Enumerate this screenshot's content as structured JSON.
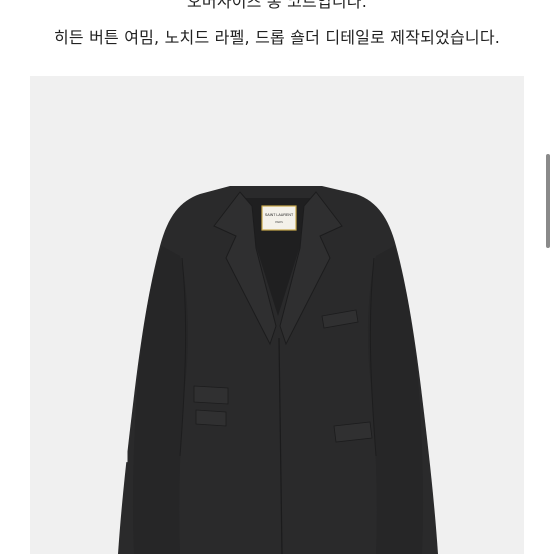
{
  "description": {
    "line1": "오버사이즈 롱 코트입니다.",
    "line2": "히든 버튼 여밈, 노치드 라펠, 드롭 숄더 디테일로 제작되었습니다."
  },
  "product_image": {
    "subject": "coat-image",
    "label_brand": "SAINT LAURENT",
    "label_city": "PARIS",
    "background_color": "#f0f0f0",
    "coat_color": "#2a2a2b"
  },
  "scrollbar": {
    "thumb_color": "#8a8a8a"
  }
}
